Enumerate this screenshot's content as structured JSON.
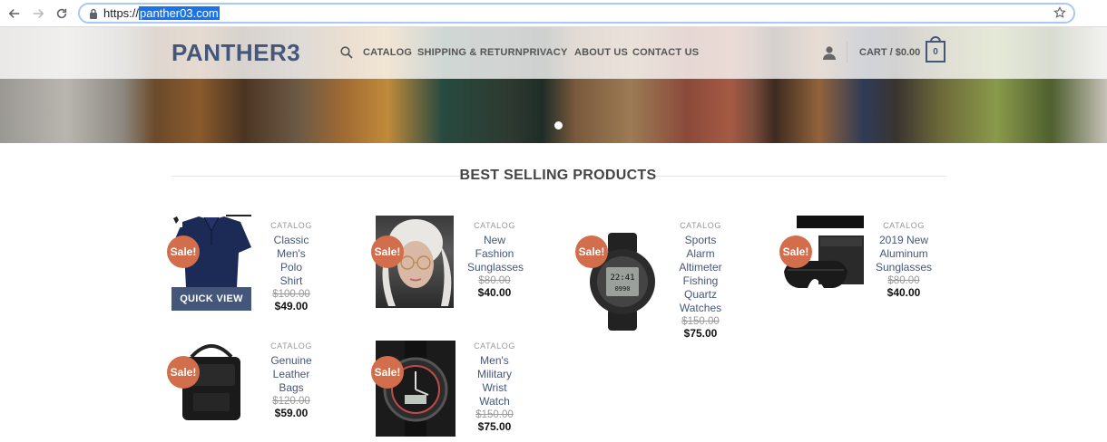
{
  "browser": {
    "url_scheme": "https://",
    "url_host": "panther03.com"
  },
  "header": {
    "logo": "PANTHER3",
    "menu": [
      "CATALOG",
      "SHIPPING & RETURN",
      "PRIVACY",
      "ABOUT US",
      "CONTACT US"
    ],
    "cart_label": "CART / $0.00",
    "cart_count": "0"
  },
  "section": {
    "title": "BEST SELLING PRODUCTS"
  },
  "products": [
    {
      "category": "CATALOG",
      "name": "Classic Men's Polo Shirt",
      "old_price": "$100.00",
      "price": "$49.00",
      "sale": "Sale!"
    },
    {
      "category": "CATALOG",
      "name": "New Fashion Sunglasses",
      "old_price": "$80.00",
      "price": "$40.00",
      "sale": "Sale!"
    },
    {
      "category": "CATALOG",
      "name": "Sports Alarm Altimeter Fishing Quartz Watches",
      "old_price": "$150.00",
      "price": "$75.00",
      "sale": "Sale!"
    },
    {
      "category": "CATALOG",
      "name": "2019 New Aluminum Sunglasses",
      "old_price": "$80.00",
      "price": "$40.00",
      "sale": "Sale!"
    },
    {
      "category": "CATALOG",
      "name": "Genuine Leather Bags",
      "old_price": "$120.00",
      "price": "$59.00",
      "sale": "Sale!"
    },
    {
      "category": "CATALOG",
      "name": "Men's Military Wrist Watch",
      "old_price": "$150.00",
      "price": "$75.00",
      "sale": "Sale!"
    }
  ],
  "quick_view_label": "QUICK VIEW",
  "colors": {
    "brand": "#44567a",
    "sale_badge": "#d26e4b",
    "url_highlight": "#1a73e8"
  },
  "icons": [
    "back-arrow-icon",
    "forward-arrow-icon",
    "reload-icon",
    "lock-icon",
    "star-icon",
    "search-icon",
    "user-icon",
    "cart-icon"
  ]
}
